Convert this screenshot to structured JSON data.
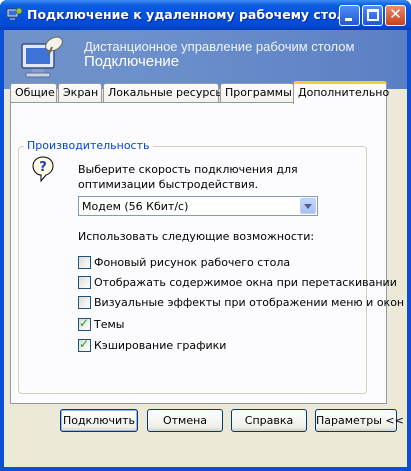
{
  "window": {
    "title": "Подключение к удаленному рабочему столу"
  },
  "banner": {
    "line1": "Дистанционное управление рабочим столом",
    "line2": "Подключение"
  },
  "tabs": [
    {
      "label": "Общие"
    },
    {
      "label": "Экран"
    },
    {
      "label": "Локальные ресурсы"
    },
    {
      "label": "Программы"
    },
    {
      "label": "Дополнительно",
      "active": true
    }
  ],
  "performance": {
    "group_label": "Производительность",
    "description": "Выберите скорость подключения для оптимизации быстродействия.",
    "speed_selected": "Модем (56 Кбит/с)",
    "features_label": "Использовать следующие возможности:",
    "options": [
      {
        "label": "Фоновый рисунок рабочего стола",
        "checked": false
      },
      {
        "label": "Отображать содержимое окна при перетаскивании",
        "checked": false
      },
      {
        "label": "Визуальные эффекты при отображении меню и окон",
        "checked": false
      },
      {
        "label": "Темы",
        "checked": true
      },
      {
        "label": "Кэширование графики",
        "checked": true
      }
    ]
  },
  "buttons": {
    "connect": "Подключить",
    "cancel": "Отмена",
    "help": "Справка",
    "options": "Параметры <<"
  }
}
